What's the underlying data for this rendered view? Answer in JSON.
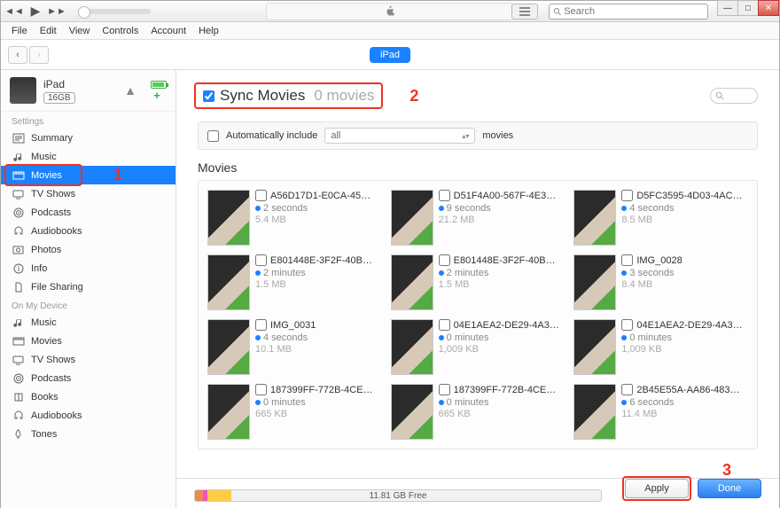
{
  "titlebar": {
    "search_placeholder": "Search"
  },
  "menu": [
    "File",
    "Edit",
    "View",
    "Controls",
    "Account",
    "Help"
  ],
  "subbar": {
    "device_label": "iPad"
  },
  "device": {
    "name": "iPad",
    "capacity": "16GB"
  },
  "sidebar": {
    "settings_title": "Settings",
    "settings": [
      {
        "label": "Summary",
        "icon": "summary"
      },
      {
        "label": "Music",
        "icon": "music"
      },
      {
        "label": "Movies",
        "icon": "movies",
        "selected": true
      },
      {
        "label": "TV Shows",
        "icon": "tv"
      },
      {
        "label": "Podcasts",
        "icon": "podcasts"
      },
      {
        "label": "Audiobooks",
        "icon": "audiobooks"
      },
      {
        "label": "Photos",
        "icon": "photos"
      },
      {
        "label": "Info",
        "icon": "info"
      },
      {
        "label": "File Sharing",
        "icon": "files"
      }
    ],
    "onmydevice_title": "On My Device",
    "onmydevice": [
      {
        "label": "Music",
        "icon": "music"
      },
      {
        "label": "Movies",
        "icon": "movies"
      },
      {
        "label": "TV Shows",
        "icon": "tv"
      },
      {
        "label": "Podcasts",
        "icon": "podcasts"
      },
      {
        "label": "Books",
        "icon": "books"
      },
      {
        "label": "Audiobooks",
        "icon": "audiobooks"
      },
      {
        "label": "Tones",
        "icon": "tones"
      }
    ]
  },
  "sync": {
    "checkbox_label": "Sync Movies",
    "count_label": "0 movies",
    "auto_label": "Automatically include",
    "auto_select_value": "all",
    "auto_suffix": "movies"
  },
  "movies_heading": "Movies",
  "movies": [
    {
      "name": "A56D17D1-E0CA-45CA-...",
      "duration": "2 seconds",
      "size": "5.4 MB"
    },
    {
      "name": "D51F4A00-567F-4E30-B...",
      "duration": "9 seconds",
      "size": "21.2 MB"
    },
    {
      "name": "D5FC3595-4D03-4ACD-...",
      "duration": "4 seconds",
      "size": "8.5 MB"
    },
    {
      "name": "E801448E-3F2F-40B5-BA...",
      "duration": "2 minutes",
      "size": "1.5 MB"
    },
    {
      "name": "E801448E-3F2F-40B5-BA...",
      "duration": "2 minutes",
      "size": "1.5 MB"
    },
    {
      "name": "IMG_0028",
      "duration": "3 seconds",
      "size": "8.4 MB"
    },
    {
      "name": "IMG_0031",
      "duration": "4 seconds",
      "size": "10.1 MB"
    },
    {
      "name": "04E1AEA2-DE29-4A30-B...",
      "duration": "0 minutes",
      "size": "1,009 KB"
    },
    {
      "name": "04E1AEA2-DE29-4A30-B...",
      "duration": "0 minutes",
      "size": "1,009 KB"
    },
    {
      "name": "187399FF-772B-4CE4-93...",
      "duration": "0 minutes",
      "size": "665 KB"
    },
    {
      "name": "187399FF-772B-4CE4-93...",
      "duration": "0 minutes",
      "size": "665 KB"
    },
    {
      "name": "2B45E55A-AA86-483B-8...",
      "duration": "6 seconds",
      "size": "11.4 MB"
    }
  ],
  "footer": {
    "free_label": "11.81 GB Free",
    "apply_label": "Apply",
    "done_label": "Done"
  },
  "annotations": {
    "n1": "1",
    "n2": "2",
    "n3": "3"
  }
}
